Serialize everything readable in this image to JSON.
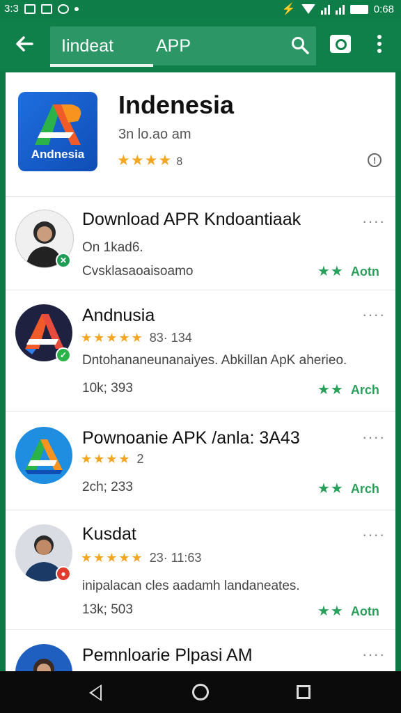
{
  "status_bar": {
    "time_left": "3:3",
    "time_right": "0:68"
  },
  "app_bar": {
    "search_text_1": "Iindeat",
    "search_text_2": "APP",
    "icons": [
      "back-arrow-icon",
      "search-icon",
      "camera-icon",
      "more-vert-icon"
    ]
  },
  "hero": {
    "icon_label": "Andnesia",
    "title": "Indenesia",
    "subtitle": "3n lo.ao am",
    "stars": "★★★★",
    "rating_count": "8"
  },
  "results": [
    {
      "title": "Download APR Kndoantiaak",
      "line1": "On 1kad6.",
      "line2": "Cvsklasaoaisoamo",
      "action": "Aotn",
      "green_stars": "★★",
      "menu": "····",
      "avatar": "person-woman",
      "badge_color": "#1f9d55"
    },
    {
      "title": "Andnusia",
      "stars": "★★★★★",
      "rating_text": "83· 134",
      "line1": "Dntohananeunanaiyes. Abkillan ApK aherieo.",
      "line2": "10k; 393",
      "action": "Arch",
      "green_stars": "★★",
      "menu": "····",
      "avatar": "a-logo-dark",
      "badge_color": "#2bb34a"
    },
    {
      "title": "Pownoanie APK /anla: 3A43",
      "stars": "★★★★",
      "rating_text": "2",
      "line1": "2ch; 233",
      "action": "Arch",
      "green_stars": "★★",
      "menu": "····",
      "avatar": "a-logo-blue"
    },
    {
      "title": "Kusdat",
      "stars": "★★★★★",
      "rating_text": "23· 11:63",
      "line1": "inipalacan cles aadamh landaneates.",
      "line2": "13k; 503",
      "action": "Aotn",
      "green_stars": "★★",
      "menu": "····",
      "avatar": "person-man",
      "badge_color": "#e03b2c"
    },
    {
      "title": "Pemnloarie Plpasi AM",
      "menu": "····",
      "avatar": "person-woman-2"
    }
  ],
  "nav_bar": {
    "icons": [
      "nav-back-icon",
      "nav-home-icon",
      "nav-recent-icon"
    ]
  }
}
